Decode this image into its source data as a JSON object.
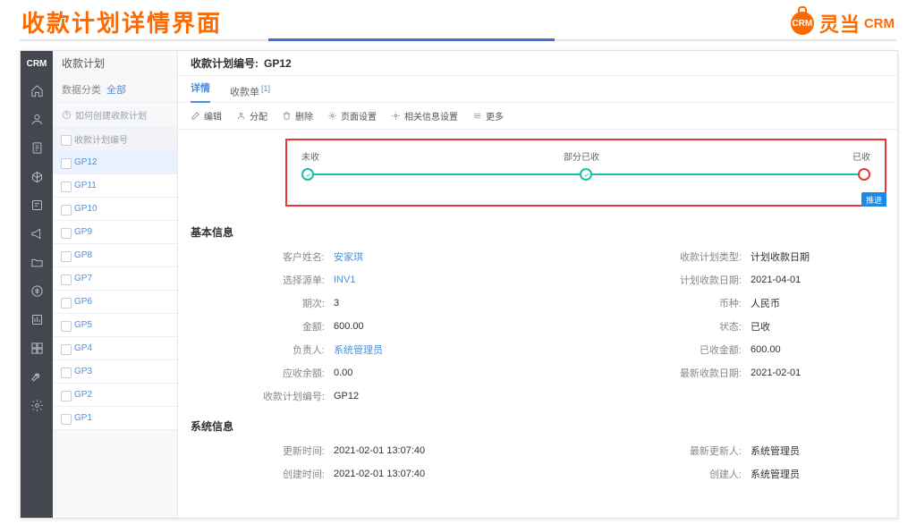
{
  "banner": {
    "title": "收款计划详情界面"
  },
  "brand": {
    "badge": "CRM",
    "name": "灵当",
    "suffix": "CRM"
  },
  "rail": {
    "logo": "CRM"
  },
  "list": {
    "title": "收款计划",
    "filter_label": "数据分类",
    "filter_value": "全部",
    "tip": "如何创建收款计划",
    "col_header": "收款计划编号",
    "rows": [
      "GP12",
      "GP11",
      "GP10",
      "GP9",
      "GP8",
      "GP7",
      "GP6",
      "GP5",
      "GP4",
      "GP3",
      "GP2",
      "GP1"
    ]
  },
  "header": {
    "label": "收款计划编号:",
    "value": "GP12"
  },
  "tabs": {
    "detail": "详情",
    "receipt": "收款单",
    "receipt_count": "[1]"
  },
  "toolbar": {
    "edit": "编辑",
    "assign": "分配",
    "delete": "删除",
    "page": "页面设置",
    "related": "相关信息设置",
    "more": "更多"
  },
  "stage": {
    "s1": "未收",
    "s2": "部分已收",
    "s3": "已收",
    "push": "推进"
  },
  "sections": {
    "basic": "基本信息",
    "system": "系统信息"
  },
  "basic": {
    "l1": "客户姓名:",
    "v1": "安家琪",
    "r1": "收款计划类型:",
    "rv1": "计划收款日期",
    "l2": "选择源单:",
    "v2": "INV1",
    "r2": "计划收款日期:",
    "rv2": "2021-04-01",
    "l3": "期次:",
    "v3": "3",
    "r3": "币种:",
    "rv3": "人民币",
    "l4": "金额:",
    "v4": "600.00",
    "r4": "状态:",
    "rv4": "已收",
    "l5": "负责人:",
    "v5": "系统管理员",
    "r5": "已收金额:",
    "rv5": "600.00",
    "l6": "应收余额:",
    "v6": "0.00",
    "r6": "最新收款日期:",
    "rv6": "2021-02-01",
    "l7": "收款计划编号:",
    "v7": "GP12"
  },
  "system": {
    "l1": "更新时间:",
    "v1": "2021-02-01 13:07:40",
    "r1": "最新更新人:",
    "rv1": "系统管理员",
    "l2": "创建时间:",
    "v2": "2021-02-01 13:07:40",
    "r2": "创建人:",
    "rv2": "系统管理员"
  }
}
